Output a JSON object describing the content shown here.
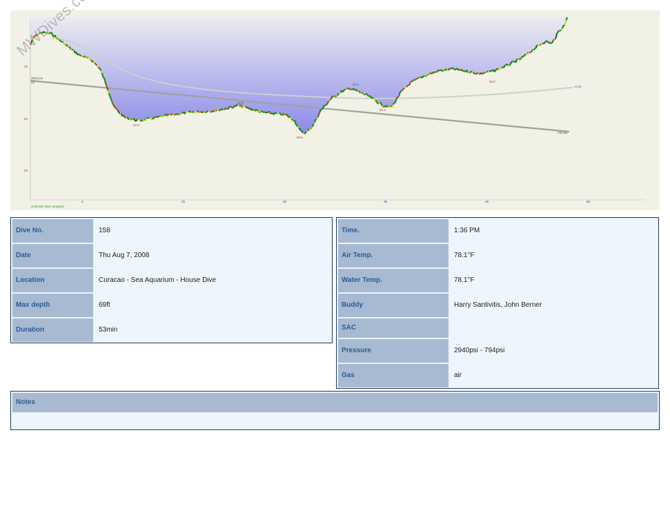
{
  "watermark": "MWDives.com",
  "profile": {
    "computer_label": "Unknown dive computer",
    "x_ticks": [
      "5",
      "15",
      "25",
      "35",
      "45",
      "55"
    ],
    "y_ticks": [
      "30",
      "60",
      "90"
    ],
    "depth_marks": [
      "62.0",
      "57.0",
      "69.0",
      "43.0",
      "51.0",
      "26.0"
    ],
    "pressure_start": "2940 psi",
    "gas_label": "Air",
    "pressure_end": "794 psi",
    "temp_end": "41.38",
    "colors": {
      "background": "#f1f1e6",
      "fill_top": "#e6e6f0",
      "fill_bottom": "#8c8ce6",
      "line_green": "#1f8a1f",
      "line_yellow": "#c8d81e",
      "line_red": "#d23c28"
    }
  },
  "left_table": [
    {
      "label": "Dive No.",
      "value": "158"
    },
    {
      "label": "Date",
      "value": "Thu Aug 7, 2008"
    },
    {
      "label": "Location",
      "value": "Curacao - Sea Aquarium - House Dive"
    },
    {
      "label": "Max depth",
      "value": "69ft"
    },
    {
      "label": "Duration",
      "value": "53min"
    }
  ],
  "right_table": [
    {
      "label": "Time.",
      "value": "1:36 PM"
    },
    {
      "label": "Air Temp.",
      "value": "78.1°F"
    },
    {
      "label": "Water Temp.",
      "value": "78.1°F"
    },
    {
      "label": "Buddy",
      "value": "Harry Santivitis, John Berner"
    },
    {
      "label": "SAC",
      "value": ""
    },
    {
      "label": "Pressure",
      "value": "2940psi - 794psi"
    },
    {
      "label": "Gas",
      "value": "air"
    }
  ],
  "notes": {
    "label": "Notes",
    "value": ""
  }
}
